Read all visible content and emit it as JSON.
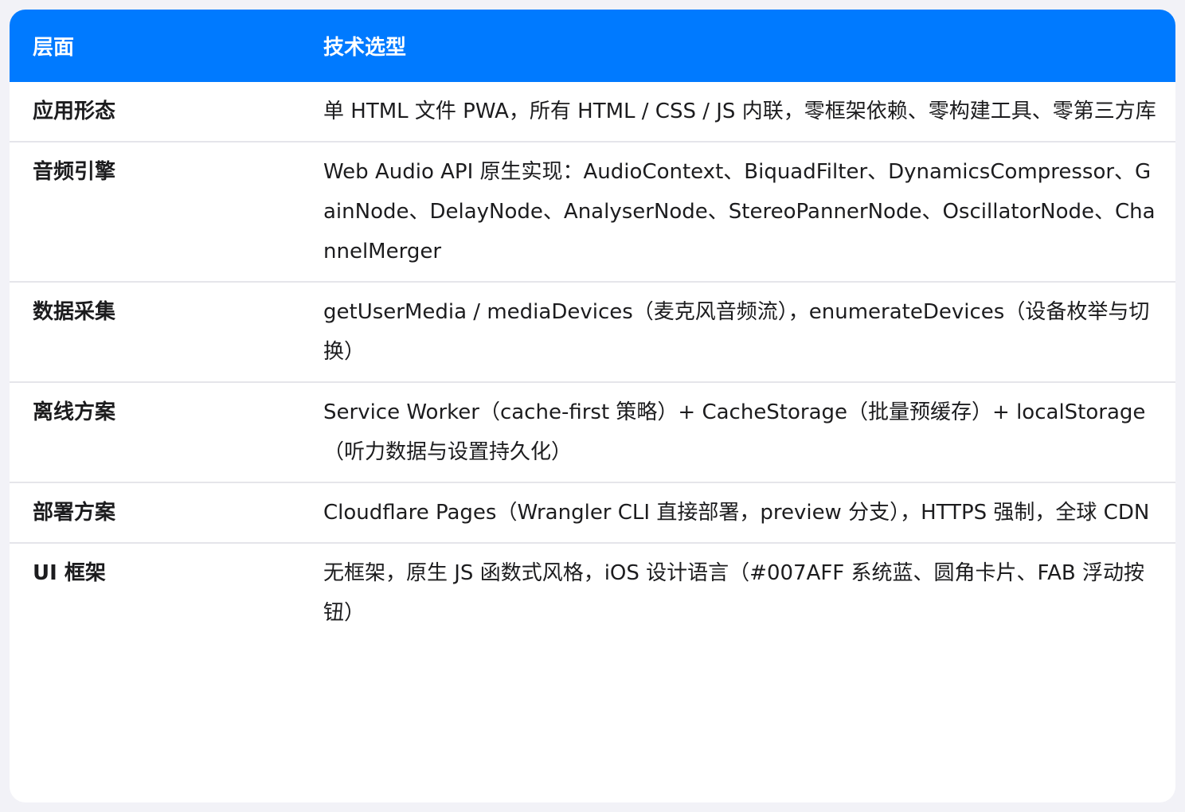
{
  "header": {
    "col1": "层面",
    "col2": "技术选型"
  },
  "rows": [
    {
      "layer": "应用形态",
      "tech": "单 HTML 文件 PWA，所有 HTML / CSS / JS 内联，零框架依赖、零构建工具、零第三方库"
    },
    {
      "layer": "音频引擎",
      "tech": "Web Audio API 原生实现：AudioContext、BiquadFilter、DynamicsCompressor、GainNode、DelayNode、AnalyserNode、StereoPannerNode、OscillatorNode、ChannelMerger"
    },
    {
      "layer": "数据采集",
      "tech": "getUserMedia / mediaDevices（麦克风音频流），enumerateDevices（设备枚举与切换）"
    },
    {
      "layer": "离线方案",
      "tech": "Service Worker（cache-first 策略）+ CacheStorage（批量预缓存）+ localStorage（听力数据与设置持久化）"
    },
    {
      "layer": "部署方案",
      "tech": "Cloudflare Pages（Wrangler CLI 直接部署，preview 分支），HTTPS 强制，全球 CDN"
    },
    {
      "layer": "UI 框架",
      "tech": "无框架，原生 JS 函数式风格，iOS 设计语言（#007AFF 系统蓝、圆角卡片、FAB 浮动按钮）"
    }
  ],
  "colors": {
    "header_bg": "#007AFF",
    "header_text": "#FFFFFF",
    "row_divider": "#E5E5EA"
  }
}
